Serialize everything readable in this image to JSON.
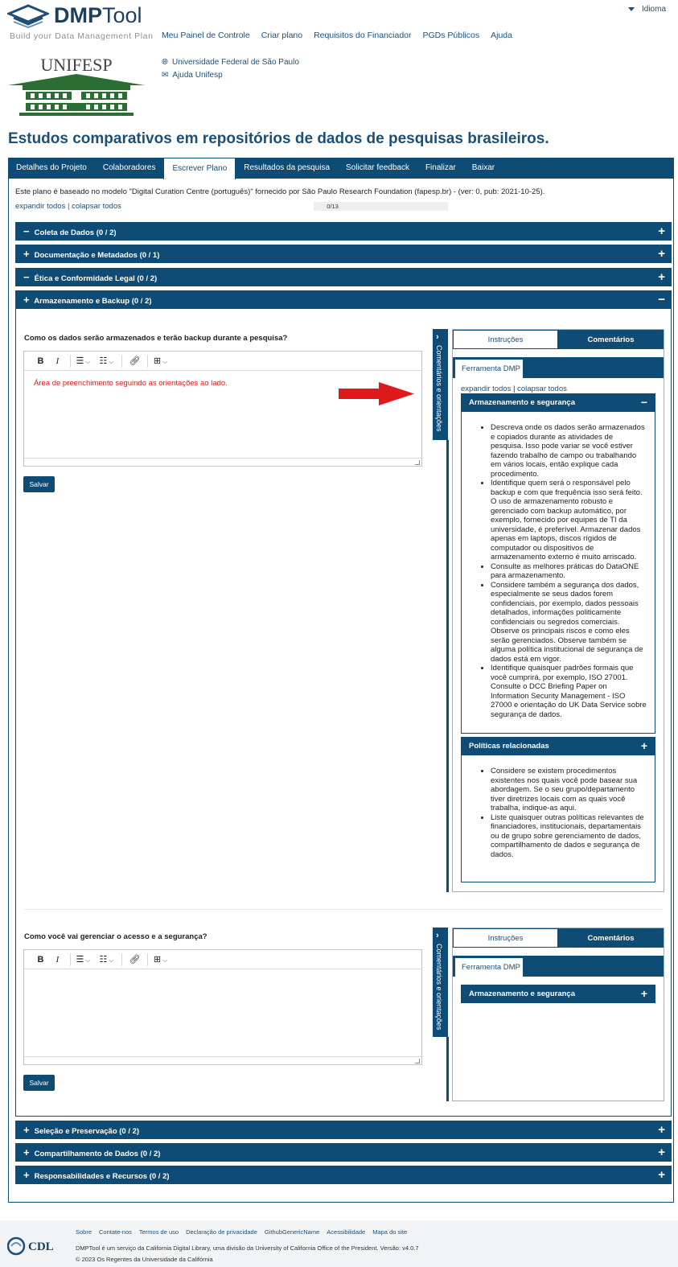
{
  "brand": {
    "name_bold": "DMP",
    "name_light": "Tool",
    "tagline": "Build your Data Management Plan"
  },
  "topnav": [
    "Meu Painel de Controle",
    "Criar plano",
    "Requisitos do Financiador",
    "PGDs Públicos",
    "Ajuda"
  ],
  "language": "Idioma",
  "institution": {
    "logo_text": "UNIFESP",
    "links": [
      "Universidade Federal de São Paulo",
      "Ajuda Unifesp"
    ]
  },
  "plan_title": "Estudos comparativos em repositórios de dados de pesquisas brasileiros.",
  "tabs": [
    "Detalhes do Projeto",
    "Colaboradores",
    "Escrever Plano",
    "Resultados da pesquisa",
    "Solicitar feedback",
    "Finalizar",
    "Baixar"
  ],
  "active_tab": "Escrever Plano",
  "plan_info": "Este plano é baseado no modelo \"Digital Curation Centre (português)\" fornecido por São Paulo Research Foundation (fapesp.br) - (ver: 0, pub: 2021-10-25).",
  "expand_all": "expandir todos",
  "collapse_all": "colapsar todos",
  "progress": {
    "label": "0/13",
    "fraction": 0
  },
  "sections": [
    {
      "label": "Coleta de Dados (0 / 2)",
      "sign": "−"
    },
    {
      "label": "Documentação e Metadados (0 / 1)",
      "sign": "+"
    },
    {
      "label": "Ética e Conformidade Legal (0 / 2)",
      "sign": "−"
    },
    {
      "label": "Armazenamento e Backup (0 / 2)",
      "sign": "+"
    }
  ],
  "bottom_sections": [
    {
      "label": "Seleção e Preservação (0 / 2)",
      "sign": "+"
    },
    {
      "label": "Compartilhamento de Dados (0 / 2)",
      "sign": "+"
    },
    {
      "label": "Responsabilidades e Recursos (0 / 2)",
      "sign": "+"
    }
  ],
  "questions": [
    {
      "text": "Como os dados serão armazenados e terão backup durante a pesquisa?",
      "answer": "Área de preenchimento seguindo as orientações ao lado.",
      "save": "Salvar"
    },
    {
      "text": "Como você vai gerenciar o acesso e a segurança?",
      "answer": "",
      "save": "Salvar"
    }
  ],
  "guidance": {
    "handle_label": "Comentários e orientações",
    "tab_instructions": "Instruções",
    "tab_comments": "Comentários",
    "tool_tab": "Ferramenta DMP",
    "expand_all": "expandir todos",
    "collapse_all": "colapsar todos",
    "storage_title": "Armazenamento e segurança",
    "storage_items": [
      "Descreva onde os dados serão armazenados e copiados durante as atividades de pesquisa. Isso pode variar se você estiver fazendo trabalho de campo ou trabalhando em vários locais, então explique cada procedimento.",
      "Identifique quem será o responsável pelo backup e com que frequência isso será feito. O uso de armazenamento robusto e gerenciado com backup automático, por exemplo, fornecido por equipes de TI da universidade, é preferível. Armazenar dados apenas em laptops, discos rígidos de computador ou dispositivos de armazenamento externo é muito arriscado.",
      "Consulte as melhores práticas do DataONE para armazenamento.",
      "Considere também a segurança dos dados, especialmente se seus dados forem confidenciais, por exemplo, dados pessoais detalhados, informações politicamente confidenciais ou segredos comerciais. Observe os principais riscos e como eles serão gerenciados. Observe também se alguma política institucional de segurança de dados está em vigor.",
      "Identifique quaisquer padrões formais que você cumprirá, por exemplo, ISO 27001. Consulte o DCC Briefing Paper on Information Security Management - ISO 27000 e orientação do UK Data Service sobre segurança de dados."
    ],
    "policies_title": "Políticas relacionadas",
    "policies_items": [
      "Considere se existem procedimentos existentes nos quais você pode basear sua abordagem. Se o seu grupo/departamento tiver diretrizes locais com as quais você trabalha, indique-as aqui.",
      "Liste quaisquer outras políticas relevantes de financiadores, institucionais, departamentais ou de grupo sobre gerenciamento de dados, compartilhamento de dados e segurança de dados."
    ]
  },
  "footer": {
    "links": [
      "Sobre",
      "Contate-nos",
      "Termos de uso",
      "Declaração de privacidade",
      "GithubGenericName",
      "Acessibilidade",
      "Mapa do site"
    ],
    "service_text": "DMPTool é um serviço da California Digital Library, uma divisão da University of California Office of the President. Versão: v4.0.7",
    "copyright": "© 2023 Os Regentes da Universidade da Califórnia",
    "cdl": "CDL"
  },
  "colors": {
    "primary": "#0f4c75",
    "link": "#1d4f77",
    "annotation": "#d21d1d"
  }
}
